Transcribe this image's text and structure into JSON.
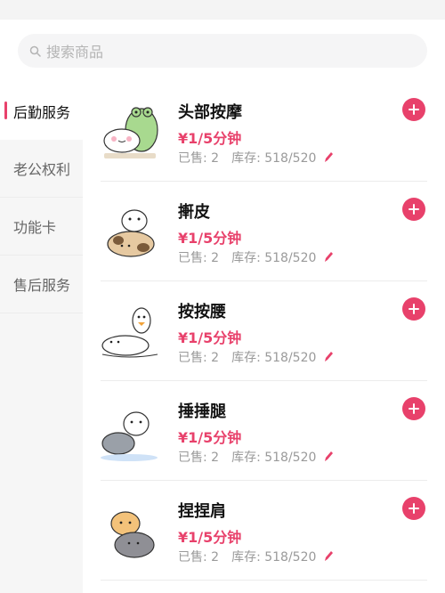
{
  "search": {
    "placeholder": "搜索商品",
    "icon": "search-icon"
  },
  "sidebar": {
    "items": [
      {
        "label": "后勤服务",
        "active": true
      },
      {
        "label": "老公权利",
        "active": false
      },
      {
        "label": "功能卡",
        "active": false
      },
      {
        "label": "售后服务",
        "active": false
      }
    ]
  },
  "products": [
    {
      "name": "头部按摩",
      "price": "¥1/5分钟",
      "sold": "已售: 2",
      "stock": "库存: 518/520",
      "image": "frog-and-cat-sticker"
    },
    {
      "name": "搟皮",
      "price": "¥1/5分钟",
      "sold": "已售: 2",
      "stock": "库存: 518/520",
      "image": "cats-rolling-sticker"
    },
    {
      "name": "按按腰",
      "price": "¥1/5分钟",
      "sold": "已售: 2",
      "stock": "库存: 518/520",
      "image": "duck-massaging-cat-sticker"
    },
    {
      "name": "捶捶腿",
      "price": "¥1/5分钟",
      "sold": "已售: 2",
      "stock": "库存: 518/520",
      "image": "cat-pounding-legs-sticker"
    },
    {
      "name": "捏捏肩",
      "price": "¥1/5分钟",
      "sold": "已售: 2",
      "stock": "库存: 518/520",
      "image": "cats-shoulder-rub-sticker"
    }
  ],
  "colors": {
    "accent": "#e8416b",
    "sidebar_bg": "#f6f6f6",
    "muted": "#9a9a9a"
  }
}
